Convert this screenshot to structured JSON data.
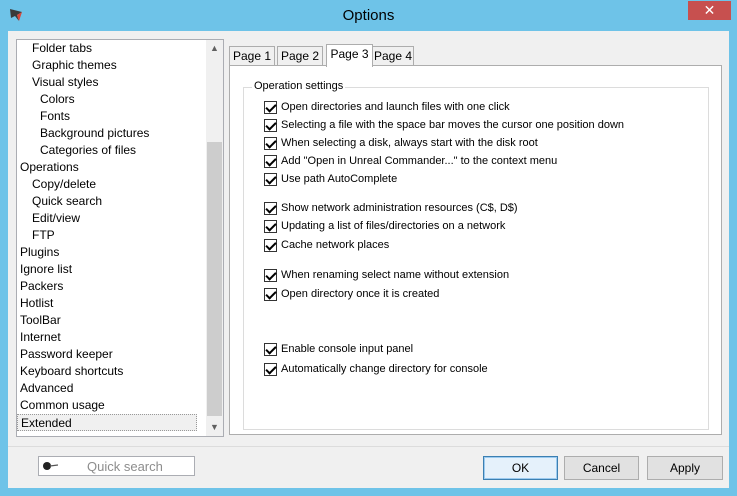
{
  "window": {
    "title": "Options",
    "close_glyph": "✕"
  },
  "tree": {
    "items": [
      {
        "label": "Folder tabs",
        "indent": 1
      },
      {
        "label": "Graphic themes",
        "indent": 1
      },
      {
        "label": "Visual styles",
        "indent": 1
      },
      {
        "label": "Colors",
        "indent": 2
      },
      {
        "label": "Fonts",
        "indent": 2
      },
      {
        "label": "Background pictures",
        "indent": 2
      },
      {
        "label": "Categories of files",
        "indent": 2
      },
      {
        "label": "Operations",
        "indent": 0
      },
      {
        "label": "Copy/delete",
        "indent": 1
      },
      {
        "label": "Quick search",
        "indent": 1
      },
      {
        "label": "Edit/view",
        "indent": 1
      },
      {
        "label": "FTP",
        "indent": 1
      },
      {
        "label": "Plugins",
        "indent": 0
      },
      {
        "label": "Ignore list",
        "indent": 0
      },
      {
        "label": "Packers",
        "indent": 0
      },
      {
        "label": "Hotlist",
        "indent": 0
      },
      {
        "label": "ToolBar",
        "indent": 0
      },
      {
        "label": "Internet",
        "indent": 0
      },
      {
        "label": "Password keeper",
        "indent": 0
      },
      {
        "label": "Keyboard shortcuts",
        "indent": 0
      },
      {
        "label": "Advanced",
        "indent": 0
      },
      {
        "label": "Common usage",
        "indent": 0
      },
      {
        "label": "Extended",
        "indent": 0,
        "selected": true
      }
    ],
    "scroll_up": "▲",
    "scroll_down": "▼"
  },
  "tabs": [
    {
      "label": "Page 1"
    },
    {
      "label": "Page 2"
    },
    {
      "label": "Page 3",
      "active": true
    },
    {
      "label": "Page 4"
    }
  ],
  "group": {
    "title": "Operation settings",
    "options": [
      {
        "label": "Open directories and launch files with one click",
        "checked": true
      },
      {
        "label": "Selecting a file with the space bar moves the cursor one position down",
        "checked": true
      },
      {
        "label": "When selecting a disk, always start with the disk root",
        "checked": true
      },
      {
        "label": "Add \"Open in Unreal Commander...\" to the context menu",
        "checked": true
      },
      {
        "label": "Use path AutoComplete",
        "checked": true
      },
      {
        "label": "Show network administration resources (C$, D$)",
        "checked": true
      },
      {
        "label": "Updating a list of files/directories on a network",
        "checked": true
      },
      {
        "label": "Cache network places",
        "checked": true
      },
      {
        "label": "When renaming select name without extension",
        "checked": true
      },
      {
        "label": "Open directory once it is created",
        "checked": true
      },
      {
        "label": "Enable console input panel",
        "checked": true
      },
      {
        "label": "Automatically change directory for console",
        "checked": true
      }
    ]
  },
  "quick_search": {
    "placeholder": "Quick search"
  },
  "buttons": {
    "ok": "OK",
    "cancel": "Cancel",
    "apply": "Apply"
  }
}
